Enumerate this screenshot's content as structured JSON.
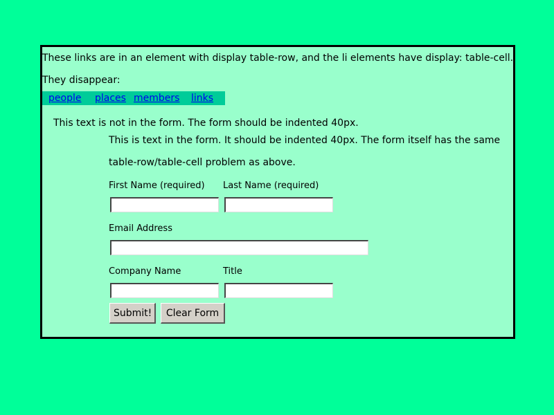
{
  "intro": {
    "line1": "These links are in an element with display table-row, and the li elements have display: table-cell.",
    "line2": "They disappear:"
  },
  "nav": {
    "links": [
      "people",
      "places",
      "members",
      "links"
    ]
  },
  "notes": {
    "outside_form": "This text is not in the form. The form should be indented 40px.",
    "in_form_line1": "This is text in the form. It should be indented 40px. The form itself has the same",
    "in_form_line2": "table-row/table-cell problem as above."
  },
  "form": {
    "first_name_label": "First Name (required)",
    "first_name_value": "",
    "last_name_label": "Last Name (required)",
    "last_name_value": "",
    "email_label": "Email Address",
    "email_value": "",
    "company_label": "Company Name",
    "company_value": "",
    "title_label": "Title",
    "title_value": "",
    "submit_label": "Submit!",
    "clear_label": "Clear Form"
  },
  "colors": {
    "page_background": "#00ff99",
    "panel_background": "#99ffcc",
    "nav_background": "#00cc99",
    "link_color": "#0000ee"
  }
}
